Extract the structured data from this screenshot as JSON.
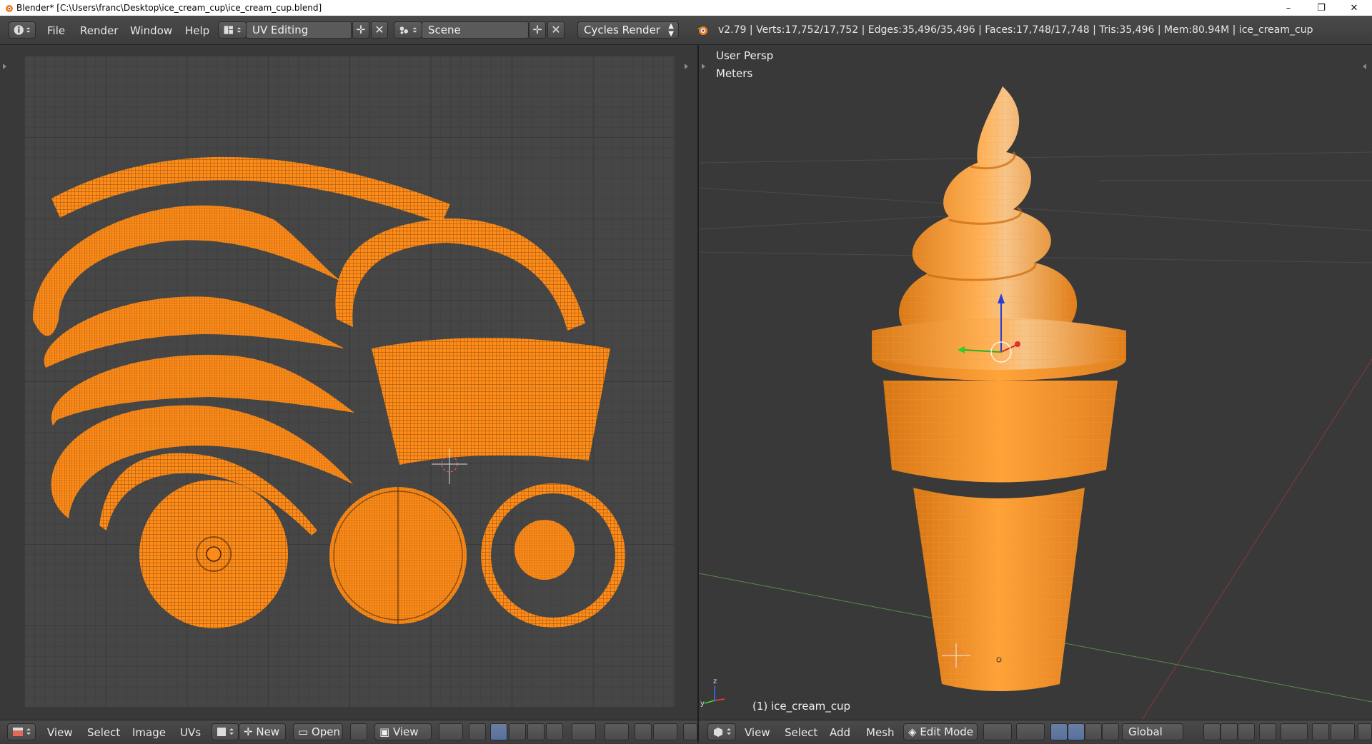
{
  "window": {
    "title": "Blender* [C:\\Users\\franc\\Desktop\\ice_cream_cup\\ice_cream_cup.blend]",
    "minimize": "–",
    "maximize": "❐",
    "close": "✕"
  },
  "info_header": {
    "menus": [
      "File",
      "Render",
      "Window",
      "Help"
    ],
    "screen_layout": "UV Editing",
    "scene": "Scene",
    "render_engine": "Cycles Render",
    "stats": "v2.79 | Verts:17,752/17,752 | Edges:35,496/35,496 | Faces:17,748/17,748 | Tris:35,496 | Mem:80.94M | ice_cream_cup"
  },
  "viewport": {
    "view_name": "User Persp",
    "units": "Meters",
    "object_label": "(1) ice_cream_cup"
  },
  "uv_editor_header": {
    "menus": [
      "View",
      "Select",
      "Image",
      "UVs"
    ],
    "new_label": "New",
    "open_label": "Open",
    "view_label": "View"
  },
  "view3d_header": {
    "menus": [
      "View",
      "Select",
      "Add",
      "Mesh"
    ],
    "mode": "Edit Mode",
    "orientation": "Global"
  },
  "colors": {
    "selection_orange": "#ff8c19",
    "background": "#393939",
    "grid": "#464646"
  }
}
